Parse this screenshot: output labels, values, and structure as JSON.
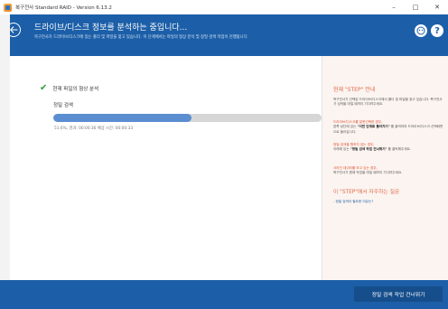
{
  "window": {
    "title": "복구전사 Standard RAID - Version 6.13.2",
    "minimize": "–",
    "maximize": "□",
    "close": "✕"
  },
  "header": {
    "title": "드라이브/디스크 정보를 분석하는 중입니다...",
    "subtitle": "복구전사가 드라이브/디스크에 있는 폴더 및 파일을 찾고 있습니다. 이 단계에서는 파일의 형상 분석 및 정밀 검색 작업이 진행됩니다."
  },
  "task": {
    "label": "현재 파일의 형상 분석",
    "subtask": "정밀 검색",
    "progress_percent": 51.6,
    "status": "51.6%, 경과: 00:00:36 예상 시간: 00:00:33"
  },
  "side": {
    "heading": "현재 \"STEP\" 안내",
    "intro": "복구전사가 선택된 드라이브/디스크에서 폴더 및 파일을 찾고 있습니다. 복구전사가 검색을 마칠 때까지 기다려주세요.",
    "cases": [
      {
        "title": "드라이브/디스크를 잘못선택한 경우,",
        "text_before": "왼쪽 상단에 있는 ",
        "bold": "\"이전 단계로 돌아가기\"",
        "text_after": " 를 클릭하여 드라이브/디스크 선택화면으로 돌아갑니다."
      },
      {
        "title": "정밀 검색을 원하지 않는 경우,",
        "text_before": "아래에 있는 ",
        "bold": "\"정밀 검색 작업 건너뛰기\"",
        "text_after": " 를 클릭해주세요."
      },
      {
        "title": "사라진 데이터를 보고 있는 경우,",
        "text_before": "복구전사가 원래 작업을 마칠 때까지 기다려주세요.",
        "bold": "",
        "text_after": ""
      }
    ],
    "faq_heading": "이 \"STEP\"에서 자주하는 질문",
    "faq_link": "- 정밀 검색이 필요한 이유는?"
  },
  "footer": {
    "skip_label": "정밀 검색 작업 건너뛰기"
  },
  "colors": {
    "header_blue": "#1c5fa8",
    "accent_orange": "#e06a4a",
    "progress": "#5b8ed0",
    "check_green": "#2e9e3a"
  }
}
